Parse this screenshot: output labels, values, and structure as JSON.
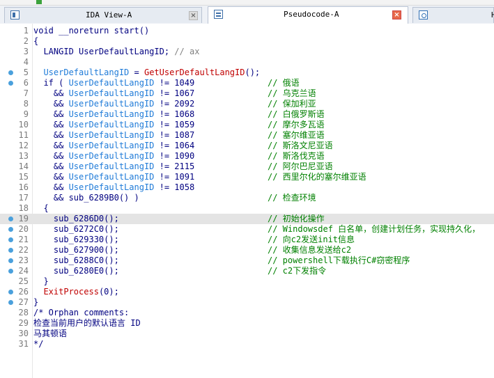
{
  "tabs": [
    {
      "label": "IDA View-A",
      "close": "close-icon-gray"
    },
    {
      "label": "Pseudocode-A",
      "close": "close-icon-red"
    },
    {
      "label": "H"
    }
  ],
  "code": {
    "lines": [
      {
        "n": "1",
        "dot": false,
        "hl": false,
        "text": "void __noreturn start()",
        "comment": ""
      },
      {
        "n": "2",
        "dot": false,
        "hl": false,
        "text": "{",
        "comment": ""
      },
      {
        "n": "3",
        "dot": false,
        "hl": false,
        "text": "  LANGID UserDefaultLangID; // ax",
        "comment": ""
      },
      {
        "n": "4",
        "dot": false,
        "hl": false,
        "text": "",
        "comment": ""
      },
      {
        "n": "5",
        "dot": true,
        "hl": false,
        "text": "  UserDefaultLangID = GetUserDefaultLangID();",
        "comment": ""
      },
      {
        "n": "6",
        "dot": true,
        "hl": false,
        "text": "  if ( UserDefaultLangID != 1049",
        "comment": "// 俄语"
      },
      {
        "n": "7",
        "dot": false,
        "hl": false,
        "text": "    && UserDefaultLangID != 1067",
        "comment": "// 乌克兰语"
      },
      {
        "n": "8",
        "dot": false,
        "hl": false,
        "text": "    && UserDefaultLangID != 2092",
        "comment": "// 保加利亚"
      },
      {
        "n": "9",
        "dot": false,
        "hl": false,
        "text": "    && UserDefaultLangID != 1068",
        "comment": "// 白俄罗斯语"
      },
      {
        "n": "10",
        "dot": false,
        "hl": false,
        "text": "    && UserDefaultLangID != 1059",
        "comment": "// 摩尔多瓦语"
      },
      {
        "n": "11",
        "dot": false,
        "hl": false,
        "text": "    && UserDefaultLangID != 1087",
        "comment": "// 塞尔维亚语"
      },
      {
        "n": "12",
        "dot": false,
        "hl": false,
        "text": "    && UserDefaultLangID != 1064",
        "comment": "// 斯洛文尼亚语"
      },
      {
        "n": "13",
        "dot": false,
        "hl": false,
        "text": "    && UserDefaultLangID != 1090",
        "comment": "// 斯洛伐克语"
      },
      {
        "n": "14",
        "dot": false,
        "hl": false,
        "text": "    && UserDefaultLangID != 2115",
        "comment": "// 阿尔巴尼亚语"
      },
      {
        "n": "15",
        "dot": false,
        "hl": false,
        "text": "    && UserDefaultLangID != 1091",
        "comment": "// 西里尔化的塞尔维亚语"
      },
      {
        "n": "16",
        "dot": false,
        "hl": false,
        "text": "    && UserDefaultLangID != 1058",
        "comment": ""
      },
      {
        "n": "17",
        "dot": false,
        "hl": false,
        "text": "    && sub_6289B0() )",
        "comment": "// 检查环境"
      },
      {
        "n": "18",
        "dot": false,
        "hl": false,
        "text": "  {",
        "comment": ""
      },
      {
        "n": "19",
        "dot": true,
        "hl": true,
        "text": "    sub_6286D0();",
        "comment": "// 初始化操作"
      },
      {
        "n": "20",
        "dot": true,
        "hl": false,
        "text": "    sub_6272C0();",
        "comment": "// Windowsdef 白名单，创建计划任务，实现持久化，"
      },
      {
        "n": "21",
        "dot": true,
        "hl": false,
        "text": "    sub_629330();",
        "comment": "// 向c2发送init信息"
      },
      {
        "n": "22",
        "dot": true,
        "hl": false,
        "text": "    sub_627900();",
        "comment": "// 收集信息发送给c2"
      },
      {
        "n": "23",
        "dot": true,
        "hl": false,
        "text": "    sub_6288C0();",
        "comment": "// powershell下载执行C#窃密程序"
      },
      {
        "n": "24",
        "dot": true,
        "hl": false,
        "text": "    sub_6280E0();",
        "comment": "// c2下发指令"
      },
      {
        "n": "25",
        "dot": false,
        "hl": false,
        "text": "  }",
        "comment": ""
      },
      {
        "n": "26",
        "dot": true,
        "hl": false,
        "text": "  ExitProcess(0);",
        "comment": ""
      },
      {
        "n": "27",
        "dot": true,
        "hl": false,
        "text": "}",
        "comment": ""
      },
      {
        "n": "28",
        "dot": false,
        "hl": false,
        "text": "/* Orphan comments:",
        "comment": ""
      },
      {
        "n": "29",
        "dot": false,
        "hl": false,
        "text": "检查当前用户的默认语言 ID",
        "comment": ""
      },
      {
        "n": "30",
        "dot": false,
        "hl": false,
        "text": "马其顿语",
        "comment": ""
      },
      {
        "n": "31",
        "dot": false,
        "hl": false,
        "text": "*/",
        "comment": ""
      }
    ]
  },
  "colors": {
    "keyword": "#000080",
    "variable": "#1f7bd8",
    "function": "#c00000",
    "comment": "#008000",
    "line_number": "#7a7a7a",
    "breakpoint_dot": "#4aa0dc",
    "highlight": "#e4e4e4",
    "close_red": "#e8684a"
  }
}
